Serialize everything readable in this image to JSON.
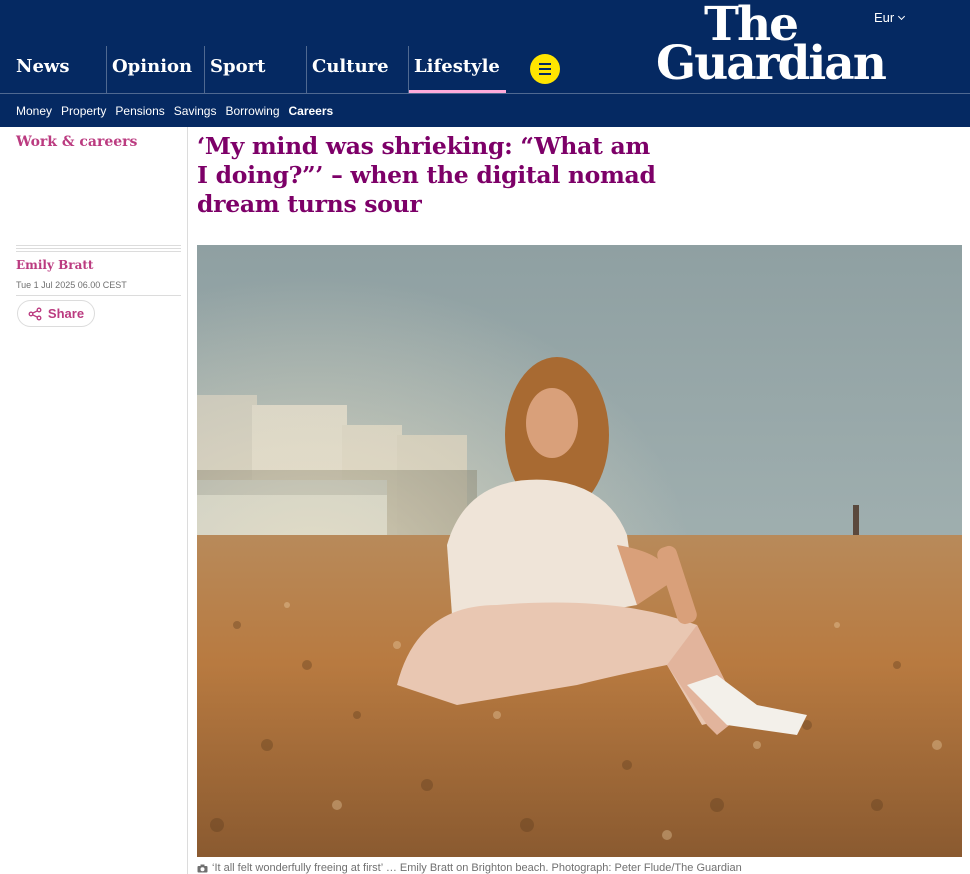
{
  "header": {
    "edition": "Eur",
    "logo_line1": "The",
    "logo_line2": "Guardian",
    "pillars": [
      {
        "label": "News"
      },
      {
        "label": "Opinion"
      },
      {
        "label": "Sport"
      },
      {
        "label": "Culture"
      },
      {
        "label": "Lifestyle"
      }
    ],
    "menu_icon": "hamburger-menu-icon"
  },
  "subnav": {
    "items": [
      "Money",
      "Property",
      "Pensions",
      "Savings",
      "Borrowing",
      "Careers"
    ]
  },
  "article": {
    "section": "Work & careers",
    "headline": "‘My mind was shrieking: “What am I doing?”’ – when the digital nomad dream turns sour",
    "author": "Emily Bratt",
    "date": "Tue 1 Jul 2025 06.00 CEST",
    "share_label": "Share",
    "caption": "‘It all felt wonderfully freeing at first’ … Emily Bratt on Brighton beach. Photograph: Peter Flude/The Guardian"
  },
  "colors": {
    "brand": "#052962",
    "headline": "#7d0068",
    "accent": "#bb3b80",
    "menu_button": "#ffe500",
    "active_underline": "#ffabdb"
  }
}
